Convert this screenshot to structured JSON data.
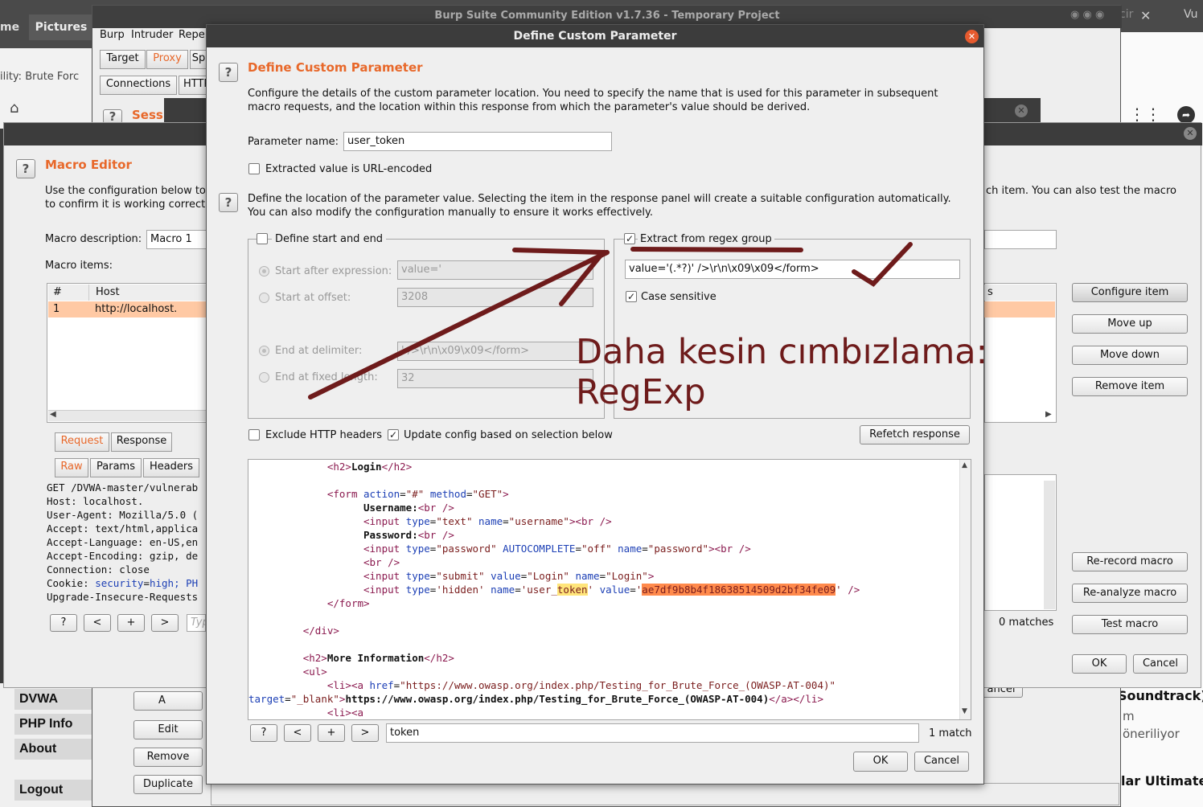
{
  "desktop": {
    "app_tab_me": "me",
    "app_tab_pictures": "Pictures",
    "browser_tab": "ility: Brute Forc",
    "burp_title": "Burp Suite Community Edition v1.7.36 - Temporary Project",
    "top_right_text_1": "cir",
    "top_right_text_2": "Vu"
  },
  "burp_main": {
    "menu": [
      "Burp",
      "Intruder",
      "Repe"
    ],
    "tabs_row1": [
      "Target",
      "Proxy",
      "Sp"
    ],
    "tabs_row2": [
      "Connections",
      "HTTP"
    ],
    "session_heading": "Sess",
    "left_buttons": [
      "A",
      "Edit",
      "Remove",
      "Duplicate"
    ],
    "cancel_partial": "ancel"
  },
  "dvwa_sidebar": [
    "DVWA Secu",
    "PHP Info",
    "About",
    "Logout"
  ],
  "browser_right": {
    "text_1": "Soundtrack) |",
    "text_2": "m",
    "text_3": "öneriliyor",
    "text_4": "lar Ultimate C"
  },
  "macro_editor": {
    "heading": "Macro Editor",
    "desc_line1": "Use the configuration below to",
    "desc_line2": "to confirm it is working correct",
    "desc_right": "ch item. You can also test the macro",
    "macro_description_label": "Macro description:",
    "macro_description_value": "Macro 1",
    "macro_items_label": "Macro items:",
    "table_headers": [
      "#",
      "Host"
    ],
    "table_rows": [
      [
        "1",
        "http://localhost."
      ]
    ],
    "s_header": "s",
    "req_tabs": [
      "Request",
      "Response"
    ],
    "sub_tabs": [
      "Raw",
      "Params",
      "Headers"
    ],
    "request_lines": [
      "GET /DVWA-master/vulnerab",
      "Host: localhost.",
      "User-Agent: Mozilla/5.0 (",
      "Accept: text/html,applica",
      "Accept-Language: en-US,en",
      "Accept-Encoding: gzip, de",
      "Connection: close",
      "Cookie: security=high; PH",
      "Upgrade-Insecure-Requests"
    ],
    "cookie_prefix": "Cookie: ",
    "cookie_key": "security",
    "cookie_eq": "=",
    "cookie_val": "high",
    "cookie_rest": "; PH",
    "nav_buttons": [
      "?",
      "<",
      "+",
      ">"
    ],
    "search_placeholder": "Typ",
    "right_buttons": [
      "Configure item",
      "Move up",
      "Move down",
      "Remove item",
      "Re-record macro",
      "Re-analyze macro",
      "Test macro"
    ],
    "matches": "0 matches",
    "ok": "OK",
    "cancel": "Cancel"
  },
  "dialog": {
    "title": "Define Custom Parameter",
    "heading": "Define Custom Parameter",
    "desc1_line1": "Configure the details of the custom parameter location. You need to specify the name that is used for this parameter in subsequent",
    "desc1_line2": "macro requests, and the location within this response from which the parameter's value should be derived.",
    "param_name_label": "Parameter name:",
    "param_name_value": "user_token",
    "url_encoded_label": "Extracted value is URL-encoded",
    "desc2_line1": "Define the location of the parameter value. Selecting the item in the response panel will create a suitable configuration automatically.",
    "desc2_line2": "You can also modify the configuration manually to ensure it works effectively.",
    "define_start_end_label": "Define start and end",
    "start_after_label": "Start after expression:",
    "start_after_value": "value='",
    "start_offset_label": "Start at offset:",
    "start_offset_value": "3208",
    "end_delim_label": "End at delimiter:",
    "end_delim_value": "' />\\r\\n\\x09\\x09</form>",
    "end_fixed_label": "End at fixed length:",
    "end_fixed_value": "32",
    "regex_label": "Extract from regex group",
    "regex_value": "value='(.*?)' />\\r\\n\\x09\\x09</form>",
    "case_sensitive_label": "Case sensitive",
    "exclude_headers_label": "Exclude HTTP headers",
    "update_config_label": "Update config based on selection below",
    "refetch_label": "Refetch response",
    "search_value": "token",
    "match_count": "1 match",
    "ok": "OK",
    "cancel": "Cancel",
    "nav_buttons": [
      "?",
      "<",
      "+",
      ">"
    ]
  },
  "response_code": {
    "login_heading": "Login",
    "form_action": "#",
    "form_method": "GET",
    "username_label": "Username:",
    "password_label": "Password:",
    "input_type_text": "text",
    "input_name_username": "username",
    "input_type_password": "password",
    "autocomplete_value": "off",
    "input_name_password": "password",
    "input_type_submit": "submit",
    "submit_value": "Login",
    "submit_name": "Login",
    "hidden_type": "hidden",
    "hidden_name_prefix": "user_",
    "hidden_name_match": "token",
    "token_value": "ae7df9b8b4f18638514509d2bf34fe09",
    "more_info": "More Information",
    "link_href": "https://www.owasp.org/index.php/Testing_for_Brute_Force_(OWASP-AT-004)",
    "link_target": "_blank",
    "link_text": "https://www.owasp.org/index.php/Testing_for_Brute_Force_(OWASP-AT-004)"
  },
  "annotation": {
    "text_line1": "Daha kesin cımbızlama:",
    "text_line2": "RegExp",
    "color": "#6e1b1b"
  },
  "colors": {
    "accent_orange": "#e8682a",
    "selected_row": "#ffc9a4",
    "token_highlight": "#ff8a4c",
    "search_highlight": "#ffe57a"
  }
}
